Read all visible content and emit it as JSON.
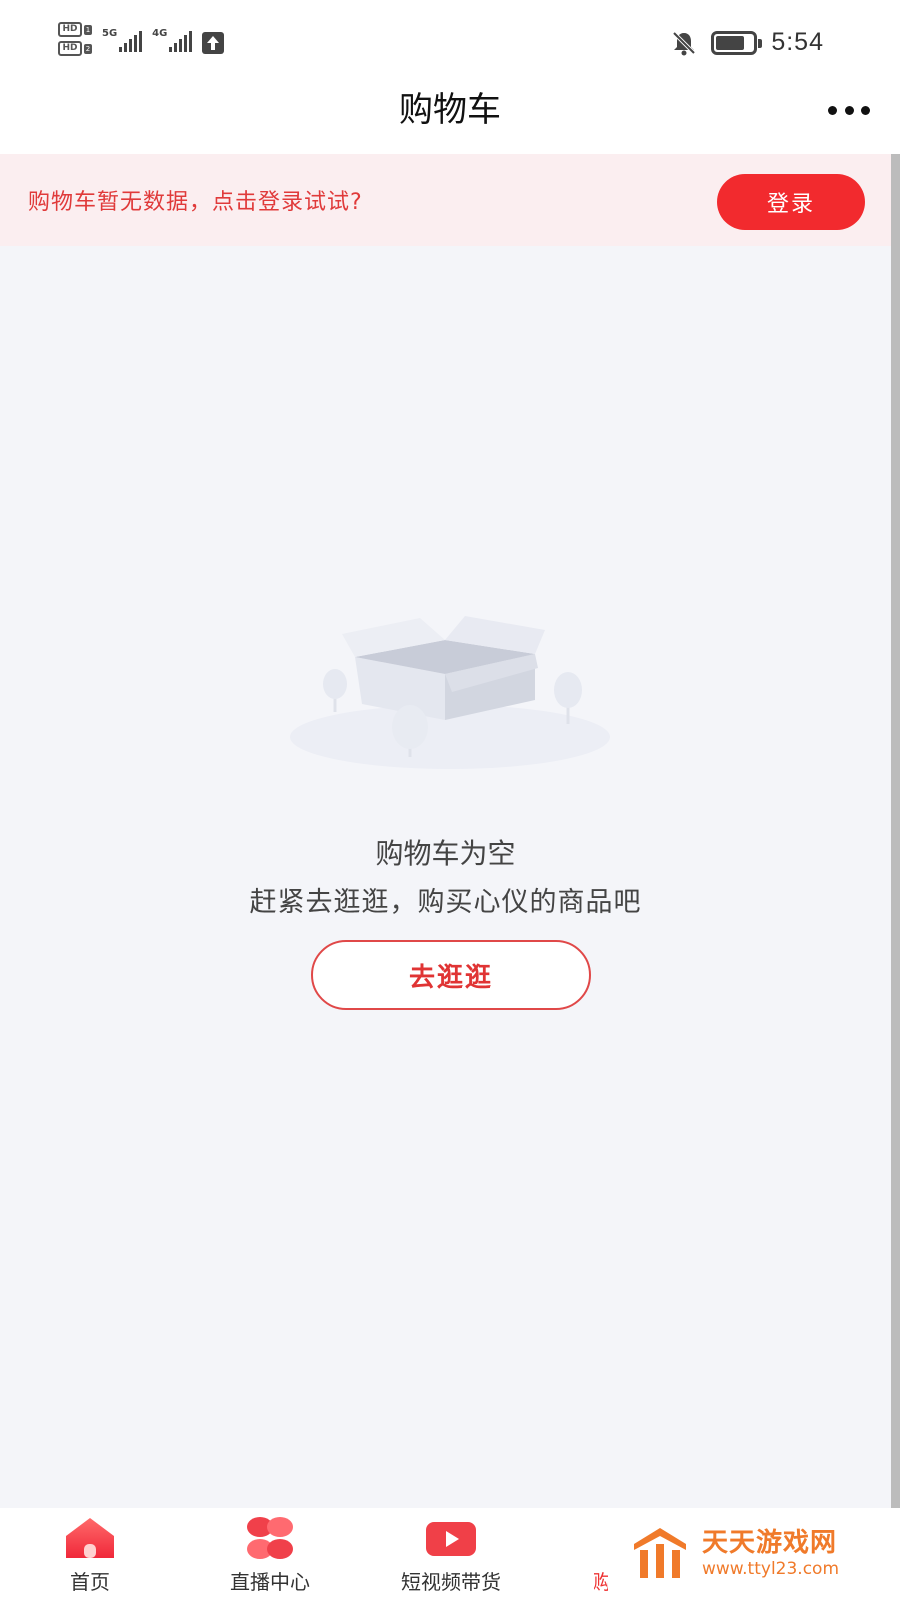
{
  "status_bar": {
    "hd1": "HD",
    "hd1_sim": "1",
    "hd2": "HD",
    "hd2_sim": "2",
    "network1": "5G",
    "network2": "4G",
    "time": "5:54",
    "icons": [
      "signal-icon",
      "upload-icon",
      "bell-off-icon",
      "battery-icon"
    ]
  },
  "nav": {
    "title": "购物车",
    "more_icon": "more-icon"
  },
  "login_banner": {
    "tip": "购物车暂无数据，点击登录试试?",
    "button_label": "登录"
  },
  "empty_state": {
    "illustration": "empty-box-illustration",
    "title": "购物车为空",
    "subtitle": "赶紧去逛逛，购买心仪的商品吧",
    "button_label": "去逛逛"
  },
  "tabs": [
    {
      "label": "首页",
      "icon": "home-icon"
    },
    {
      "label": "直播中心",
      "icon": "live-center-icon"
    },
    {
      "label": "短视频带货",
      "icon": "video-play-icon"
    },
    {
      "label": "购",
      "icon": "cart-icon",
      "active": true
    }
  ],
  "watermark": {
    "title": "天天游戏网",
    "url": "www.ttyl23.com"
  },
  "colors": {
    "accent": "#f22a2e",
    "banner_bg": "#fbeef0",
    "page_bg": "#f4f5f9",
    "watermark": "#f07a2a"
  }
}
